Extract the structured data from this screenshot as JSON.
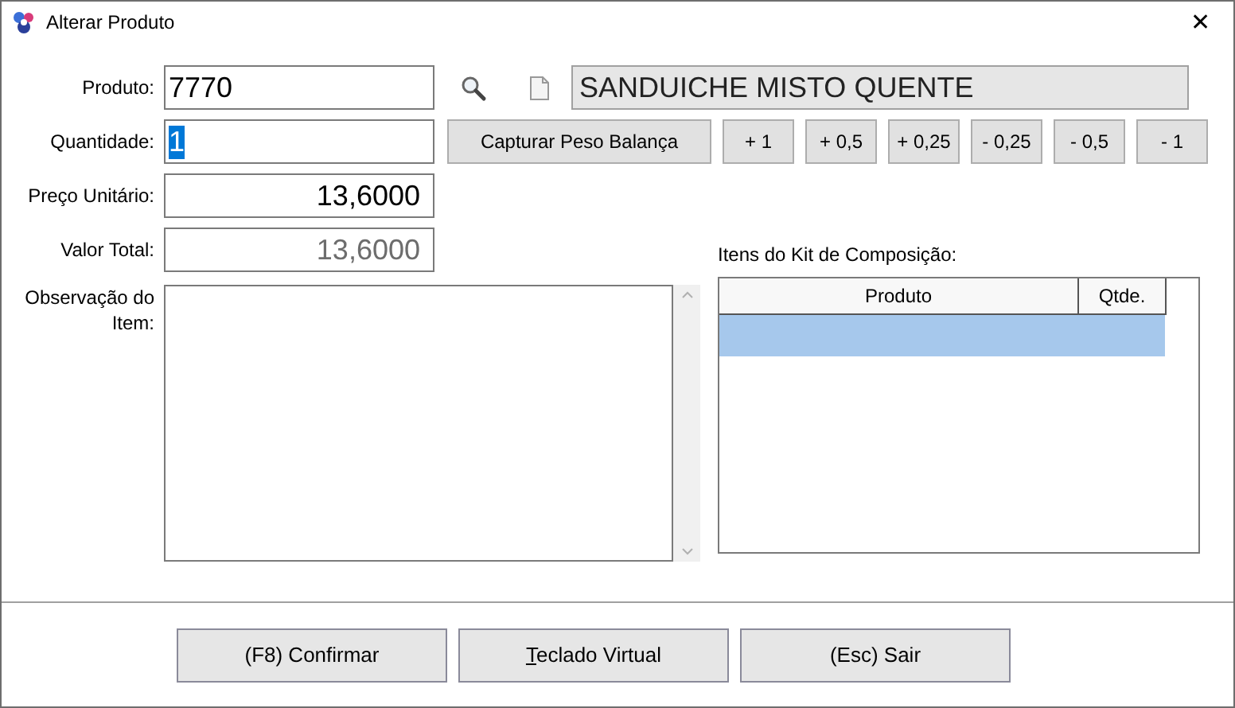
{
  "window": {
    "title": "Alterar Produto",
    "close": "✕"
  },
  "form": {
    "produto": {
      "label": "Produto:",
      "value": "7770",
      "name": "SANDUICHE MISTO QUENTE"
    },
    "quantidade": {
      "label": "Quantidade:",
      "value": "1",
      "selected": true
    },
    "preco": {
      "label": "Preço Unitário:",
      "value": "13,6000",
      "disabled": false
    },
    "valor_total": {
      "label": "Valor Total:",
      "value": "13,6000",
      "disabled": true
    },
    "observacao": {
      "label": "Observação do Item:"
    }
  },
  "scale_button": "Capturar Peso Balança",
  "quantity_buttons": [
    "+ 1",
    "+ 0,5",
    "+ 0,25",
    "- 0,25",
    "- 0,5",
    "- 1"
  ],
  "kit": {
    "label": "Itens do Kit de Composição:",
    "columns": [
      "Produto",
      "Qtde."
    ],
    "rows": [
      {
        "selected": true
      }
    ]
  },
  "footer_buttons": [
    {
      "label": "(F8) Confirmar",
      "underline_first": false
    },
    {
      "label": "Teclado Virtual",
      "underline_first": true
    },
    {
      "label": "(Esc) Sair",
      "underline_first": false
    }
  ]
}
